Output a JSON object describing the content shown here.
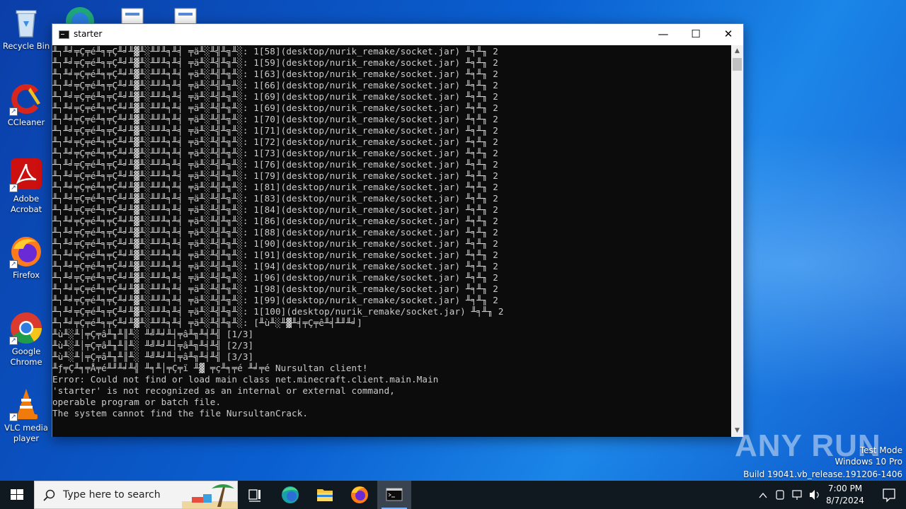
{
  "desktop": {
    "icons": [
      {
        "label": "Recycle Bin",
        "icon": "recycle-bin-icon"
      },
      {
        "label": "CCleaner",
        "icon": "ccleaner-icon"
      },
      {
        "label": "Adobe Acrobat",
        "icon": "adobe-acrobat-icon"
      },
      {
        "label": "Firefox",
        "icon": "firefox-icon"
      },
      {
        "label": "Google Chrome",
        "icon": "chrome-icon"
      },
      {
        "label": "VLC media player",
        "icon": "vlc-icon"
      }
    ]
  },
  "window": {
    "title": "starter",
    "minimize": "—",
    "maximize": "☐",
    "close": "✕",
    "console_lines": [
      "╨┐╨╛╤Ç╤é╨╕╤Ç╨╛╨▓╨░╨╜╨╕╨╡ ╤ä╨░╨╣╨╗╨░: 1[58](desktop/nurik_remake/socket.jar) ╨╕╨╖ 2",
      "╨┐╨╛╤Ç╤é╨╕╤Ç╨╛╨▓╨░╨╜╨╕╨╡ ╤ä╨░╨╣╨╗╨░: 1[59](desktop/nurik_remake/socket.jar) ╨╕╨╖ 2",
      "╨┐╨╛╤Ç╤é╨╕╤Ç╨╛╨▓╨░╨╜╨╕╨╡ ╤ä╨░╨╣╨╗╨░: 1[63](desktop/nurik_remake/socket.jar) ╨╕╨╖ 2",
      "╨┐╨╛╤Ç╤é╨╕╤Ç╨╛╨▓╨░╨╜╨╕╨╡ ╤ä╨░╨╣╨╗╨░: 1[66](desktop/nurik_remake/socket.jar) ╨╕╨╖ 2",
      "╨┐╨╛╤Ç╤é╨╕╤Ç╨╛╨▓╨░╨╜╨╕╨╡ ╤ä╨░╨╣╨╗╨░: 1[69](desktop/nurik_remake/socket.jar) ╨╕╨╖ 2",
      "╨┐╨╛╤Ç╤é╨╕╤Ç╨╛╨▓╨░╨╜╨╕╨╡ ╤ä╨░╨╣╨╗╨░: 1[69](desktop/nurik_remake/socket.jar) ╨╕╨╖ 2",
      "╨┐╨╛╤Ç╤é╨╕╤Ç╨╛╨▓╨░╨╜╨╕╨╡ ╤ä╨░╨╣╨╗╨░: 1[70](desktop/nurik_remake/socket.jar) ╨╕╨╖ 2",
      "╨┐╨╛╤Ç╤é╨╕╤Ç╨╛╨▓╨░╨╜╨╕╨╡ ╤ä╨░╨╣╨╗╨░: 1[71](desktop/nurik_remake/socket.jar) ╨╕╨╖ 2",
      "╨┐╨╛╤Ç╤é╨╕╤Ç╨╛╨▓╨░╨╜╨╕╨╡ ╤ä╨░╨╣╨╗╨░: 1[72](desktop/nurik_remake/socket.jar) ╨╕╨╖ 2",
      "╨┐╨╛╤Ç╤é╨╕╤Ç╨╛╨▓╨░╨╜╨╕╨╡ ╤ä╨░╨╣╨╗╨░: 1[73](desktop/nurik_remake/socket.jar) ╨╕╨╖ 2",
      "╨┐╨╛╤Ç╤é╨╕╤Ç╨╛╨▓╨░╨╜╨╕╨╡ ╤ä╨░╨╣╨╗╨░: 1[76](desktop/nurik_remake/socket.jar) ╨╕╨╖ 2",
      "╨┐╨╛╤Ç╤é╨╕╤Ç╨╛╨▓╨░╨╜╨╕╨╡ ╤ä╨░╨╣╨╗╨░: 1[79](desktop/nurik_remake/socket.jar) ╨╕╨╖ 2",
      "╨┐╨╛╤Ç╤é╨╕╤Ç╨╛╨▓╨░╨╜╨╕╨╡ ╤ä╨░╨╣╨╗╨░: 1[81](desktop/nurik_remake/socket.jar) ╨╕╨╖ 2",
      "╨┐╨╛╤Ç╤é╨╕╤Ç╨╛╨▓╨░╨╜╨╕╨╡ ╤ä╨░╨╣╨╗╨░: 1[83](desktop/nurik_remake/socket.jar) ╨╕╨╖ 2",
      "╨┐╨╛╤Ç╤é╨╕╤Ç╨╛╨▓╨░╨╜╨╕╨╡ ╤ä╨░╨╣╨╗╨░: 1[84](desktop/nurik_remake/socket.jar) ╨╕╨╖ 2",
      "╨┐╨╛╤Ç╤é╨╕╤Ç╨╛╨▓╨░╨╜╨╕╨╡ ╤ä╨░╨╣╨╗╨░: 1[86](desktop/nurik_remake/socket.jar) ╨╕╨╖ 2",
      "╨┐╨╛╤Ç╤é╨╕╤Ç╨╛╨▓╨░╨╜╨╕╨╡ ╤ä╨░╨╣╨╗╨░: 1[88](desktop/nurik_remake/socket.jar) ╨╕╨╖ 2",
      "╨┐╨╛╤Ç╤é╨╕╤Ç╨╛╨▓╨░╨╜╨╕╨╡ ╤ä╨░╨╣╨╗╨░: 1[90](desktop/nurik_remake/socket.jar) ╨╕╨╖ 2",
      "╨┐╨╛╤Ç╤é╨╕╤Ç╨╛╨▓╨░╨╜╨╕╨╡ ╤ä╨░╨╣╨╗╨░: 1[91](desktop/nurik_remake/socket.jar) ╨╕╨╖ 2",
      "╨┐╨╛╤Ç╤é╨╕╤Ç╨╛╨▓╨░╨╜╨╕╨╡ ╤ä╨░╨╣╨╗╨░: 1[94](desktop/nurik_remake/socket.jar) ╨╕╨╖ 2",
      "╨┐╨╛╤Ç╤é╨╕╤Ç╨╛╨▓╨░╨╜╨╕╨╡ ╤ä╨░╨╣╨╗╨░: 1[96](desktop/nurik_remake/socket.jar) ╨╕╨╖ 2",
      "╨┐╨╛╤Ç╤é╨╕╤Ç╨╛╨▓╨░╨╜╨╕╨╡ ╤ä╨░╨╣╨╗╨░: 1[98](desktop/nurik_remake/socket.jar) ╨╕╨╖ 2",
      "╨┐╨╛╤Ç╤é╨╕╤Ç╨╛╨▓╨░╨╜╨╕╨╡ ╤ä╨░╨╣╨╗╨░: 1[99](desktop/nurik_remake/socket.jar) ╨╕╨╖ 2",
      "╨┐╨╛╤Ç╤é╨╕╤Ç╨╛╨▓╨░╨╜╨╕╨╡ ╤ä╨░╨╣╨╗╨░: 1[100](desktop/nurik_remake/socket.jar) ╨╕╨╖ 2",
      "╨┐╨╛╤Ç╤é╨╕╤Ç╨╛╨▓╨░╨╜╨╕╨╡ ╤ä╨░╨╣╨╗╨░: [╨ù╨░╨▓╨╡╤Ç╤ê╨╡╨╜╨╛]",
      "╨ù╨░╨│╤Ç╤â╨╖╨║╨░ ╨╝╨╛╨┤╤â╨╗╨╡╨╣ [1/3]",
      "╨ù╨░╨│╤Ç╤â╨╖╨║╨░ ╨╝╨╛╨┤╤â╨╗╨╡╨╣ [2/3]",
      "╨ù╨░╨│╤Ç╤â╨╖╨║╨░ ╨╝╨╛╨┤╤â╨╗╨╡╨╣ [3/3]",
      "╨ƒ╤Ç╨╕╤Å╤é╨╜╨╛╨╣ ╨╕╨│╤Ç╤ï ╨▓ ╤ç╨╕╤é ╨╛╤é Nursultan client!",
      "Error: Could not find or load main class net.minecraft.client.main.Main",
      "'starter' is not recognized as an internal or external command,",
      "operable program or batch file.",
      "The system cannot find the file NursultanCrack."
    ]
  },
  "watermark": {
    "brand": "ANY RUN",
    "mode": "Test Mode",
    "os": "Windows 10 Pro",
    "build": "Build 19041.vb_release.191206-1406"
  },
  "taskbar": {
    "search_placeholder": "Type here to search",
    "apps": [
      "task-view-icon",
      "edge-icon",
      "file-explorer-icon",
      "firefox-icon",
      "cmd-icon"
    ],
    "clock_time": "7:00 PM",
    "clock_date": "8/7/2024"
  },
  "colors": {
    "desktop_blue": "#0a5fd0",
    "console_bg": "#0c0c0c",
    "console_fg": "#cccccc",
    "taskbar_bg": "#101820"
  }
}
